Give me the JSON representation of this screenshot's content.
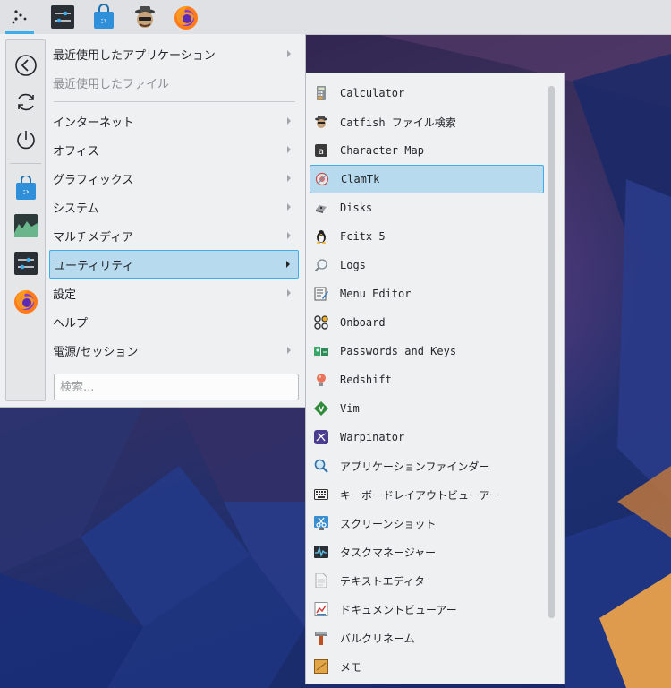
{
  "panel": {
    "items": [
      {
        "icon": "app-launcher-icon",
        "active": true
      },
      {
        "icon": "settings-sliders-icon"
      },
      {
        "icon": "software-store-bag-icon"
      },
      {
        "icon": "catfish-search-icon"
      },
      {
        "icon": "firefox-icon"
      }
    ]
  },
  "sidebar": {
    "items": [
      {
        "icon": "back-arrow-icon"
      },
      {
        "icon": "refresh-icon"
      },
      {
        "icon": "power-icon"
      },
      {
        "icon": "software-store-bag-icon"
      },
      {
        "icon": "system-monitor-icon"
      },
      {
        "icon": "settings-sliders-icon"
      },
      {
        "icon": "firefox-icon"
      }
    ]
  },
  "menu": {
    "items": [
      {
        "label": "最近使用したアプリケーション",
        "submenu": true
      },
      {
        "label": "最近使用したファイル",
        "disabled": true
      },
      {
        "label": "インターネット",
        "submenu": true
      },
      {
        "label": "オフィス",
        "submenu": true
      },
      {
        "label": "グラフィックス",
        "submenu": true
      },
      {
        "label": "システム",
        "submenu": true
      },
      {
        "label": "マルチメディア",
        "submenu": true
      },
      {
        "label": "ユーティリティ",
        "submenu": true,
        "selected": true
      },
      {
        "label": "設定",
        "submenu": true
      },
      {
        "label": "ヘルプ"
      },
      {
        "label": "電源/セッション",
        "submenu": true
      }
    ],
    "search_placeholder": "検索..."
  },
  "submenu": {
    "items": [
      {
        "label": "Calculator",
        "icon": "calculator-icon"
      },
      {
        "label": "Catfish ファイル検索",
        "icon": "catfish-icon"
      },
      {
        "label": "Character Map",
        "icon": "character-map-icon"
      },
      {
        "label": "ClamTk",
        "icon": "clamtk-icon",
        "selected": true
      },
      {
        "label": "Disks",
        "icon": "disks-icon"
      },
      {
        "label": "Fcitx 5",
        "icon": "penguin-icon"
      },
      {
        "label": "Logs",
        "icon": "logs-magnifier-icon"
      },
      {
        "label": "Menu Editor",
        "icon": "menu-editor-icon"
      },
      {
        "label": "Onboard",
        "icon": "onboard-keyboard-icon"
      },
      {
        "label": "Passwords and Keys",
        "icon": "passwords-keys-icon"
      },
      {
        "label": "Redshift",
        "icon": "redshift-bulb-icon"
      },
      {
        "label": "Vim",
        "icon": "vim-icon"
      },
      {
        "label": "Warpinator",
        "icon": "warpinator-icon"
      },
      {
        "label": "アプリケーションファインダー",
        "icon": "app-finder-magnifier-icon"
      },
      {
        "label": "キーボードレイアウトビューアー",
        "icon": "keyboard-icon"
      },
      {
        "label": "スクリーンショット",
        "icon": "screenshot-scissors-icon"
      },
      {
        "label": "タスクマネージャー",
        "icon": "task-manager-icon"
      },
      {
        "label": "テキストエディタ",
        "icon": "text-editor-icon"
      },
      {
        "label": "ドキュメントビューアー",
        "icon": "document-viewer-icon"
      },
      {
        "label": "バルクリネーム",
        "icon": "bulk-rename-icon"
      },
      {
        "label": "メモ",
        "icon": "notes-icon"
      }
    ]
  },
  "colors": {
    "accent": "#3daee9",
    "selection": "#b7daee",
    "menu_bg": "#eff0f1"
  }
}
